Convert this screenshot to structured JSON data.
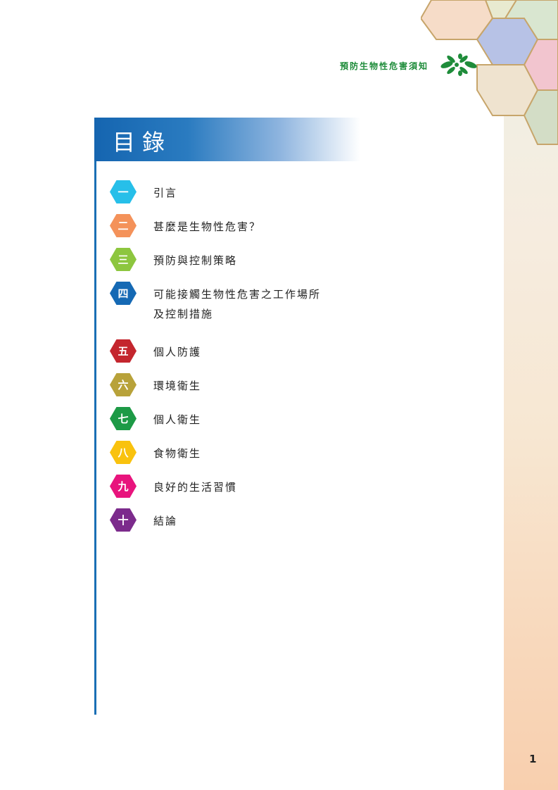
{
  "header": {
    "title": "預防生物性危害須知"
  },
  "toc": {
    "heading": "目錄",
    "items": [
      {
        "num": "一",
        "label": "引言",
        "color": "#27bfe9"
      },
      {
        "num": "二",
        "label": "甚麼是生物性危害？",
        "color": "#f4925a"
      },
      {
        "num": "三",
        "label": "預防與控制策略",
        "color": "#8dc63f"
      },
      {
        "num": "四",
        "label": "可能接觸生物性危害之工作場所",
        "label2": "及控制措施",
        "color": "#1569b4"
      },
      {
        "num": "五",
        "label": "個人防護",
        "color": "#c4262e"
      },
      {
        "num": "六",
        "label": "環境衛生",
        "color": "#b8a23a"
      },
      {
        "num": "七",
        "label": "個人衛生",
        "color": "#1d9a46"
      },
      {
        "num": "八",
        "label": "食物衛生",
        "color": "#f9c20e"
      },
      {
        "num": "九",
        "label": "良好的生活習慣",
        "color": "#e8147d"
      },
      {
        "num": "十",
        "label": "結論",
        "color": "#7c2b8c"
      }
    ]
  },
  "page": {
    "number": "1"
  },
  "colors": {
    "accent_blue": "#1565b0",
    "header_green": "#1e8c3a"
  }
}
